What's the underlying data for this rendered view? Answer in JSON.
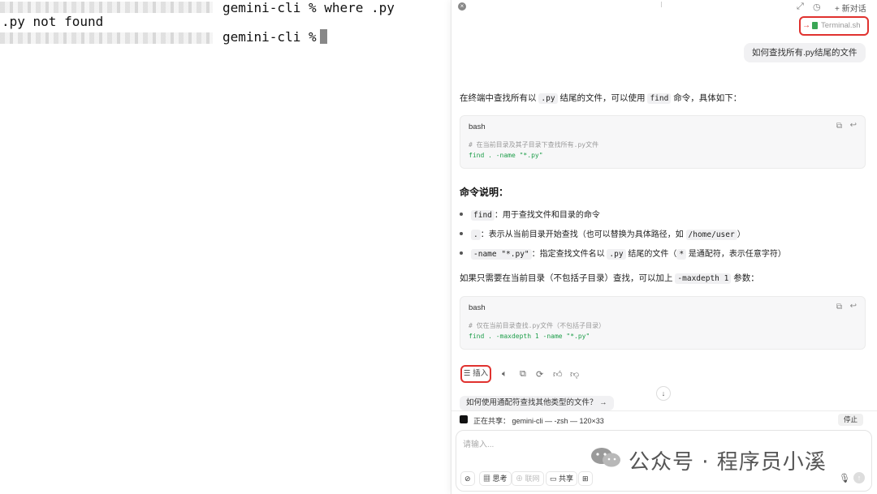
{
  "terminal": {
    "line1_cmd": "gemini-cli % where .py",
    "line2": ".py not found",
    "line3_prompt": "gemini-cli %"
  },
  "panel": {
    "close_label": "×",
    "new_chat_label": "+ 新对话",
    "file_chip": {
      "arrow": "→",
      "name": "Terminal.sh"
    },
    "user_message": "如何查找所有.py结尾的文件",
    "intro": {
      "pre": "在终端中查找所有以 ",
      "code1": ".py",
      "mid": " 结尾的文件，可以使用 ",
      "code2": "find",
      "post": " 命令，具体如下："
    },
    "code_block_1": {
      "lang": "bash",
      "comment": "# 在当前目录及其子目录下查找所有.py文件",
      "cmd": "find . -name \"*.py\""
    },
    "section_heading": "命令说明：",
    "bullets": [
      {
        "code": "find",
        "text": "：用于查找文件和目录的命令"
      },
      {
        "code": ".",
        "text": "：表示从当前目录开始查找（也可以替换为具体路径，如 ",
        "code2": "/home/user",
        "text2": "）"
      },
      {
        "code": "-name \"*.py\"",
        "text": "：指定查找文件名以 ",
        "code2": ".py",
        "text2": " 结尾的文件（",
        "code3": "*",
        "text3": " 是通配符，表示任意字符）"
      }
    ],
    "extra_para": {
      "pre": "如果只需要在当前目录（不包括子目录）查找，可以加上 ",
      "code": "-maxdepth 1",
      "post": " 参数："
    },
    "code_block_2": {
      "lang": "bash",
      "comment": "# 仅在当前目录查找.py文件（不包括子目录）",
      "cmd": "find . -maxdepth 1 -name \"*.py\""
    },
    "insert_label": "☰ 插入",
    "suggestion": "如何使用通配符查找其他类型的文件？ →",
    "share_text": "正在共享：  gemini-cli — -zsh — 120×33",
    "stop_label": "停止",
    "input_placeholder": "请输入...",
    "tools": {
      "think": "思考",
      "search": "联网",
      "share": "共享"
    }
  },
  "watermark": "公众号 · 程序员小溪",
  "colors": {
    "highlight": "#e0322f",
    "code_keyword": "#1e9e4a"
  }
}
